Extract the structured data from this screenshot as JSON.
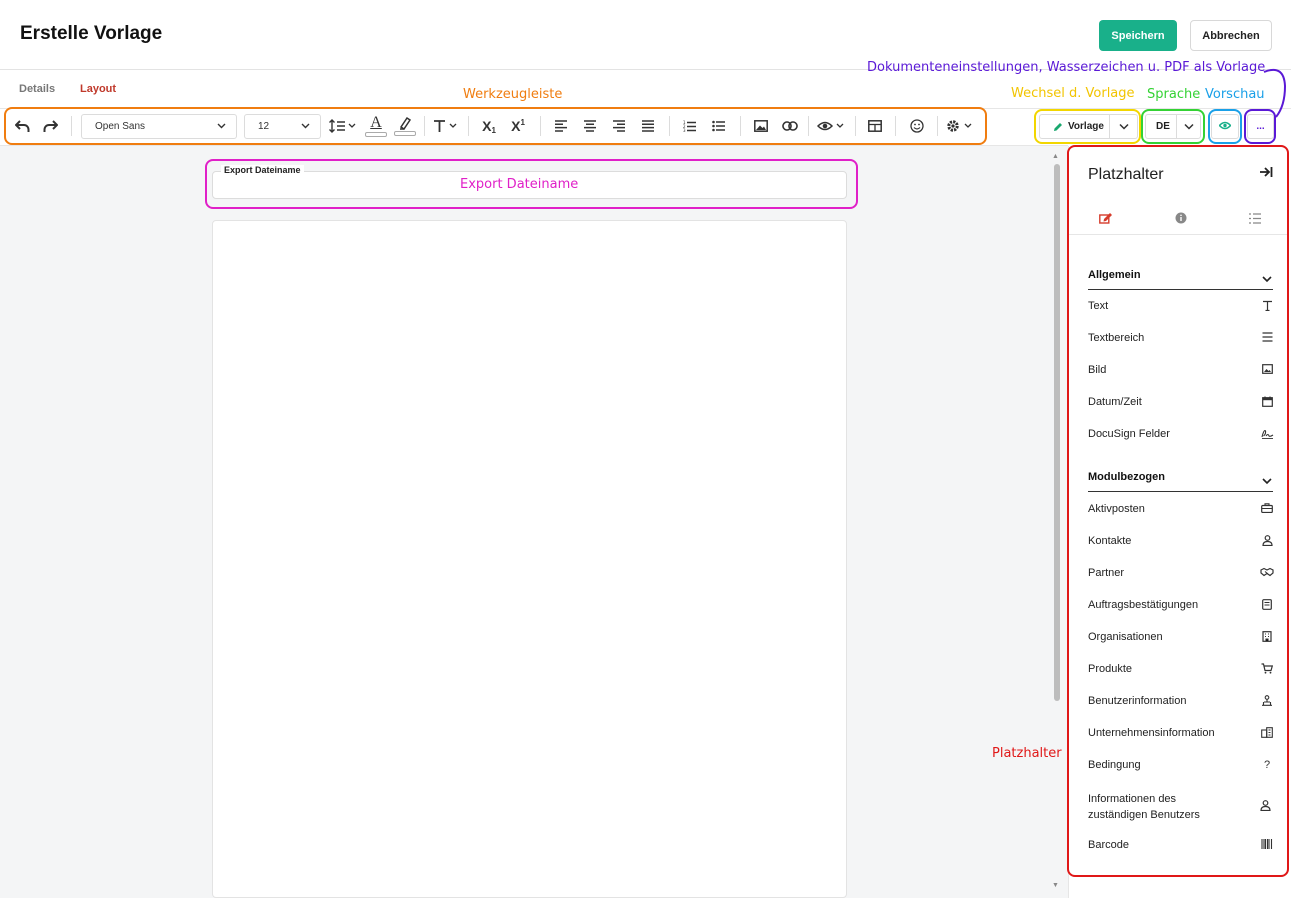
{
  "header": {
    "title": "Erstelle Vorlage",
    "save_label": "Speichern",
    "cancel_label": "Abbrechen"
  },
  "tabs": [
    {
      "label": "Details"
    },
    {
      "label": "Layout"
    }
  ],
  "toolbar": {
    "font_family": "Open Sans",
    "font_size": "12"
  },
  "right_toolbar": {
    "template_label": "Vorlage",
    "language_label": "DE",
    "more_label": "..."
  },
  "editor": {
    "filename_label": "Export Dateiname",
    "filename_value": ""
  },
  "annotations": {
    "toolbar": "Werkzeugleiste",
    "filename": "Export Dateiname",
    "template_switch": "Wechsel d. Vorlage",
    "language": "Sprache",
    "preview": "Vorschau",
    "document_settings": "Dokumenteneinstellungen, Wasserzeichen u. PDF als Vorlage",
    "placeholder": "Platzhalter",
    "colors": {
      "orange": "#f07d10",
      "magenta": "#e020c8",
      "yellow": "#f2d600",
      "green": "#34d234",
      "blue": "#1aa0e8",
      "purple": "#5a19d6",
      "red": "#e01818"
    }
  },
  "panel": {
    "title": "Platzhalter",
    "sections": [
      {
        "title": "Allgemein",
        "items": [
          {
            "label": "Text",
            "icon": "text-icon"
          },
          {
            "label": "Textbereich",
            "icon": "lines-icon"
          },
          {
            "label": "Bild",
            "icon": "image-icon"
          },
          {
            "label": "Datum/Zeit",
            "icon": "calendar-icon"
          },
          {
            "label": "DocuSign Felder",
            "icon": "signature-icon"
          }
        ]
      },
      {
        "title": "Modulbezogen",
        "items": [
          {
            "label": "Aktivposten",
            "icon": "briefcase-icon"
          },
          {
            "label": "Kontakte",
            "icon": "person-icon"
          },
          {
            "label": "Partner",
            "icon": "handshake-icon"
          },
          {
            "label": "Auftragsbestätigungen",
            "icon": "receipt-icon"
          },
          {
            "label": "Organisationen",
            "icon": "building-icon"
          },
          {
            "label": "Produkte",
            "icon": "cart-icon"
          },
          {
            "label": "Benutzerinformation",
            "icon": "user-info-icon"
          },
          {
            "label": "Unternehmensinformation",
            "icon": "company-icon"
          },
          {
            "label": "Bedingung",
            "icon": "question-icon"
          },
          {
            "label": "Informationen des zuständigen Benutzers",
            "icon": "person-icon"
          },
          {
            "label": "Barcode",
            "icon": "barcode-icon"
          }
        ]
      }
    ]
  }
}
